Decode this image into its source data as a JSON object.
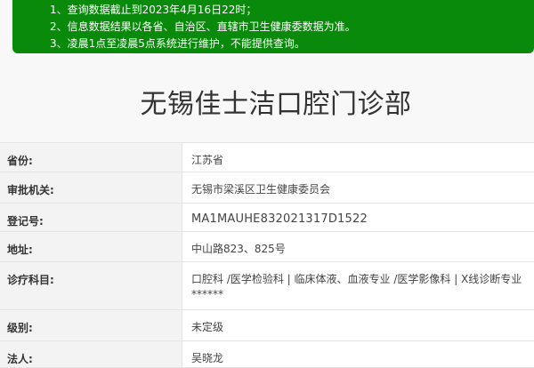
{
  "notice": {
    "lines": [
      "1、查询数据截止到2023年4月16日22时；",
      "2、信息数据结果以各省、自治区、直辖市卫生健康委数据为准。",
      "3、凌晨1点至凌晨5点系统进行维护，不能提供查询。"
    ]
  },
  "clinic_name": "无锡佳士洁口腔门诊部",
  "info": {
    "province": {
      "label": "省份:",
      "value": "江苏省"
    },
    "approval_authority": {
      "label": "审批机关:",
      "value": "无锡市梁溪区卫生健康委员会"
    },
    "registration_no": {
      "label": "登记号:",
      "value": "MA1MAUHE832021317D1522"
    },
    "address": {
      "label": "地址:",
      "value": "中山路823、825号"
    },
    "departments": {
      "label": "诊疗科目:",
      "value_line1": "口腔科 /医学检验科 | 临床体液、血液专业 /医学影像科 | X线诊断专业",
      "value_line2": "******"
    },
    "level": {
      "label": "级别:",
      "value": "未定级"
    },
    "legal_person": {
      "label": "法人:",
      "value": "吴晓龙"
    }
  }
}
